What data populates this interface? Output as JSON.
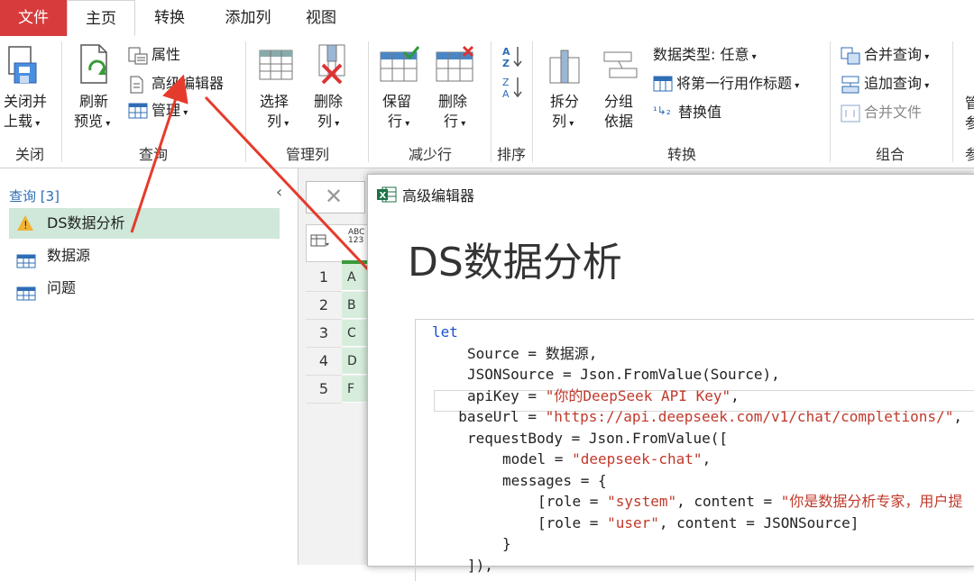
{
  "tabs": [
    "文件",
    "主页",
    "转换",
    "添加列",
    "视图"
  ],
  "ribbon": {
    "close": {
      "line1": "关闭并",
      "line2": "上载",
      "group": "关闭"
    },
    "query": {
      "refresh1": "刷新",
      "refresh2": "预览",
      "properties": "属性",
      "advanced_editor": "高级编辑器",
      "manage": "管理",
      "group": "查询"
    },
    "manage_cols": {
      "choose1": "选择",
      "choose2": "列",
      "remove1": "删除",
      "remove2": "列",
      "group": "管理列"
    },
    "reduce_rows": {
      "keep1": "保留",
      "keep2": "行",
      "remove1": "删除",
      "remove2": "行",
      "group": "减少行"
    },
    "sort": {
      "group": "排序"
    },
    "transform": {
      "split1": "拆分",
      "split2": "列",
      "groupby1": "分组",
      "groupby2": "依据",
      "datatype": "数据类型: 任意",
      "first_row": "将第一行用作标题",
      "replace": "替换值",
      "group": "转换"
    },
    "combine": {
      "merge": "合并查询",
      "append": "追加查询",
      "combine_files": "合并文件",
      "group": "组合"
    },
    "partial1": "管",
    "partial2": "参",
    "partial3": "参"
  },
  "queries": {
    "header": "查询 [3]",
    "items": [
      "DS数据分析",
      "数据源",
      "问题"
    ]
  },
  "grid": {
    "col_type": "ABC\n123",
    "rows": [
      {
        "num": "1",
        "val": "A"
      },
      {
        "num": "2",
        "val": "B"
      },
      {
        "num": "3",
        "val": "C"
      },
      {
        "num": "4",
        "val": "D"
      },
      {
        "num": "5",
        "val": "F"
      }
    ]
  },
  "dialog": {
    "title": "高级编辑器",
    "heading": "DS数据分析",
    "code": [
      {
        "indent": 0,
        "parts": [
          [
            "kw",
            "let"
          ]
        ]
      },
      {
        "indent": 1,
        "parts": [
          [
            "t",
            "Source = 数据源,"
          ]
        ]
      },
      {
        "indent": 1,
        "parts": [
          [
            "t",
            "JSONSource = Json.FromValue(Source),"
          ]
        ]
      },
      {
        "indent": 1,
        "parts": [
          [
            "t",
            "apiKey = "
          ],
          [
            "str",
            "\"你的DeepSeek API Key\""
          ],
          [
            "t",
            ","
          ]
        ]
      },
      {
        "indent": 0.75,
        "parts": [
          [
            "t",
            "baseUrl = "
          ],
          [
            "str",
            "\"https://api.deepseek.com/v1/chat/completions/\""
          ],
          [
            "t",
            ","
          ]
        ]
      },
      {
        "indent": 1,
        "parts": [
          [
            "t",
            "requestBody = Json.FromValue(["
          ]
        ]
      },
      {
        "indent": 2,
        "parts": [
          [
            "t",
            "model = "
          ],
          [
            "str",
            "\"deepseek-chat\""
          ],
          [
            "t",
            ","
          ]
        ]
      },
      {
        "indent": 2,
        "parts": [
          [
            "t",
            "messages = {"
          ]
        ]
      },
      {
        "indent": 3,
        "parts": [
          [
            "t",
            "[role = "
          ],
          [
            "str",
            "\"system\""
          ],
          [
            "t",
            ", content = "
          ],
          [
            "str",
            "\"你是数据分析专家，用户提"
          ]
        ]
      },
      {
        "indent": 3,
        "parts": [
          [
            "t",
            "[role = "
          ],
          [
            "str",
            "\"user\""
          ],
          [
            "t",
            ", content = JSONSource]"
          ]
        ]
      },
      {
        "indent": 2,
        "parts": [
          [
            "t",
            "}"
          ]
        ]
      },
      {
        "indent": 1,
        "parts": [
          [
            "t",
            "]),"
          ]
        ]
      }
    ]
  },
  "colors": {
    "file_tab": "#d83b3b",
    "selected_query": "#cfe8d9",
    "arrow": "#e53b2c",
    "excel": "#1e7145"
  }
}
